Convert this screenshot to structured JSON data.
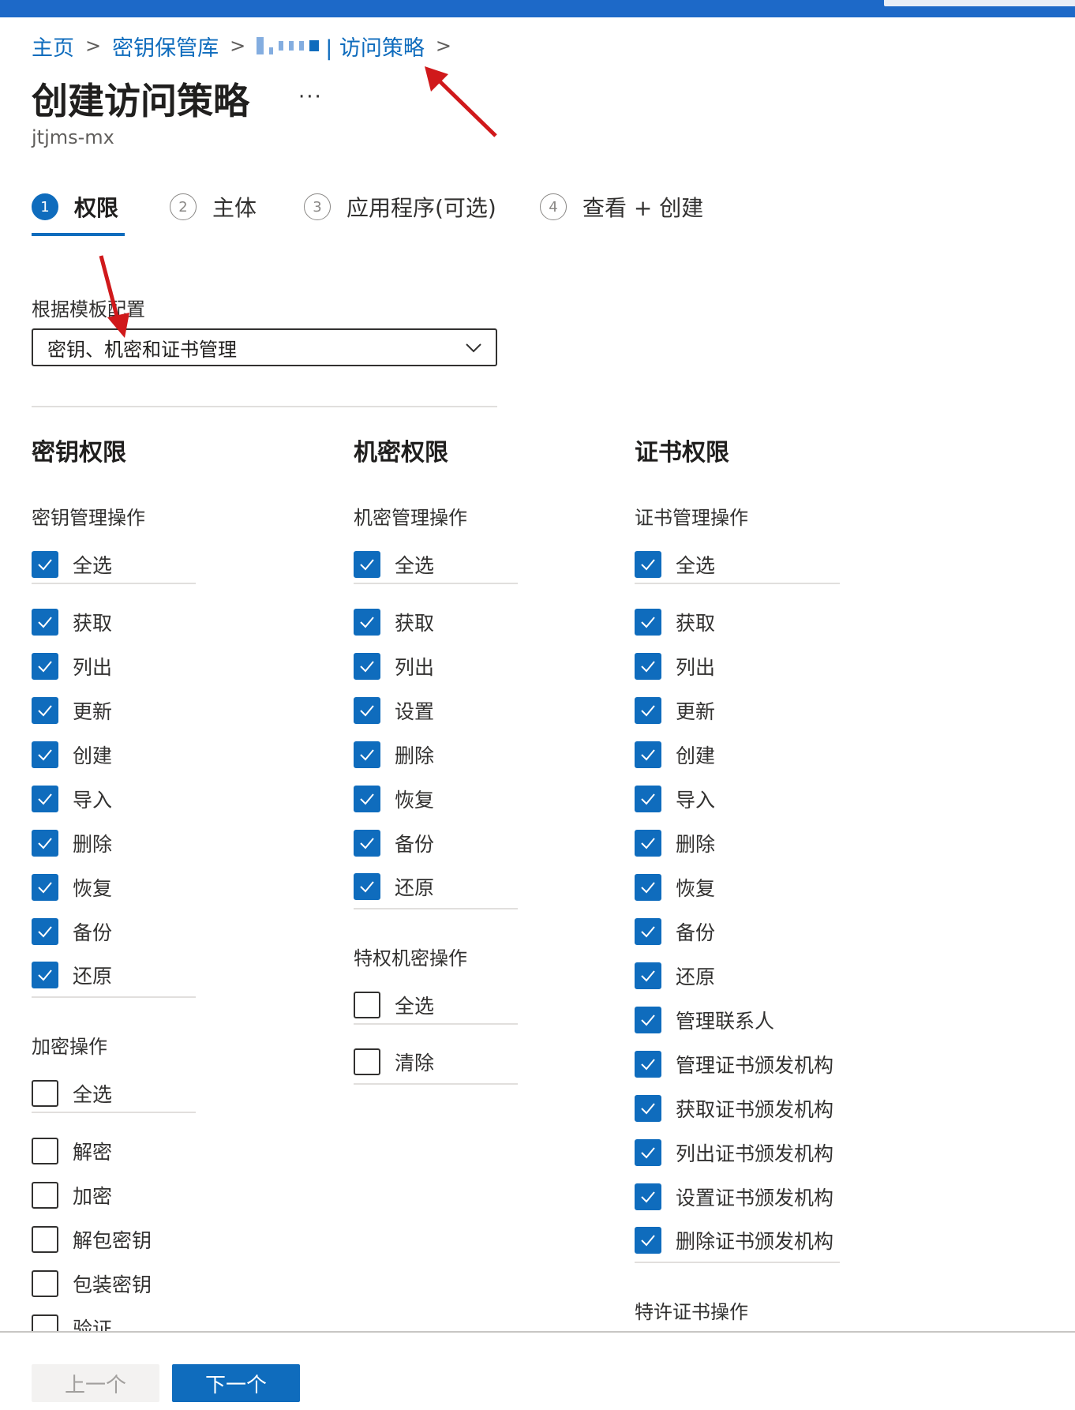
{
  "breadcrumb": {
    "items": [
      "主页",
      "密钥保管库"
    ],
    "current": "| 访问策略",
    "separator": ">"
  },
  "page": {
    "title": "创建访问策略",
    "more": "···",
    "subtitle": "jtjms-mx"
  },
  "wizard": {
    "steps": [
      {
        "number": "1",
        "label": "权限",
        "active": true
      },
      {
        "number": "2",
        "label": "主体",
        "active": false
      },
      {
        "number": "3",
        "label": "应用程序(可选)",
        "active": false
      },
      {
        "number": "4",
        "label": "查看 + 创建",
        "active": false
      }
    ]
  },
  "template": {
    "label": "根据模板配置",
    "value": "密钥、机密和证书管理"
  },
  "key_permissions": {
    "heading": "密钥权限",
    "management": {
      "title": "密钥管理操作",
      "select_all": "全选",
      "items": [
        "获取",
        "列出",
        "更新",
        "创建",
        "导入",
        "删除",
        "恢复",
        "备份",
        "还原"
      ]
    },
    "crypto": {
      "title": "加密操作",
      "select_all": "全选",
      "items": [
        "解密",
        "加密",
        "解包密钥",
        "包装密钥",
        "验证"
      ]
    }
  },
  "secret_permissions": {
    "heading": "机密权限",
    "management": {
      "title": "机密管理操作",
      "select_all": "全选",
      "items": [
        "获取",
        "列出",
        "设置",
        "删除",
        "恢复",
        "备份",
        "还原"
      ]
    },
    "privileged": {
      "title": "特权机密操作",
      "select_all": "全选",
      "items": [
        "清除"
      ]
    }
  },
  "certificate_permissions": {
    "heading": "证书权限",
    "management": {
      "title": "证书管理操作",
      "select_all": "全选",
      "items": [
        "获取",
        "列出",
        "更新",
        "创建",
        "导入",
        "删除",
        "恢复",
        "备份",
        "还原",
        "管理联系人",
        "管理证书颁发机构",
        "获取证书颁发机构",
        "列出证书颁发机构",
        "设置证书颁发机构",
        "删除证书颁发机构"
      ]
    },
    "privileged": {
      "title": "特许证书操作"
    }
  },
  "footer": {
    "prev": "上一个",
    "next": "下一个"
  },
  "colors": {
    "accent": "#0f6cbd",
    "topbar": "#1d69c8",
    "annotation_arrow": "#d0191b"
  }
}
